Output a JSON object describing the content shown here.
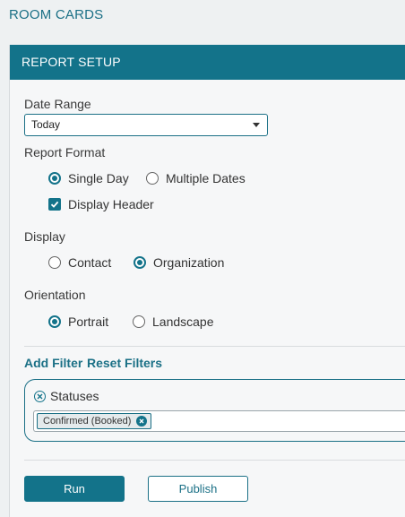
{
  "page": {
    "title": "ROOM CARDS"
  },
  "panel": {
    "header": "REPORT SETUP"
  },
  "date_range": {
    "label": "Date Range",
    "selected": "Today"
  },
  "report_format": {
    "label": "Report Format",
    "options": [
      {
        "label": "Single Day",
        "checked": true
      },
      {
        "label": "Multiple Dates",
        "checked": false
      }
    ],
    "display_header": {
      "label": "Display Header",
      "checked": true
    }
  },
  "display": {
    "label": "Display",
    "options": [
      {
        "label": "Contact",
        "checked": false
      },
      {
        "label": "Organization",
        "checked": true
      }
    ]
  },
  "orientation": {
    "label": "Orientation",
    "options": [
      {
        "label": "Portrait",
        "checked": true
      },
      {
        "label": "Landscape",
        "checked": false
      }
    ]
  },
  "filters": {
    "add_label": "Add Filter",
    "reset_label": "Reset Filters",
    "statuses": {
      "title": "Statuses",
      "tags": [
        "Confirmed (Booked)"
      ]
    }
  },
  "actions": {
    "run_label": "Run",
    "publish_label": "Publish"
  },
  "colors": {
    "accent": "#13738a",
    "title": "#1b7086"
  },
  "icons": {
    "remove": "close-circle-icon",
    "dropdown": "chevron-down-icon",
    "check": "check-icon"
  }
}
